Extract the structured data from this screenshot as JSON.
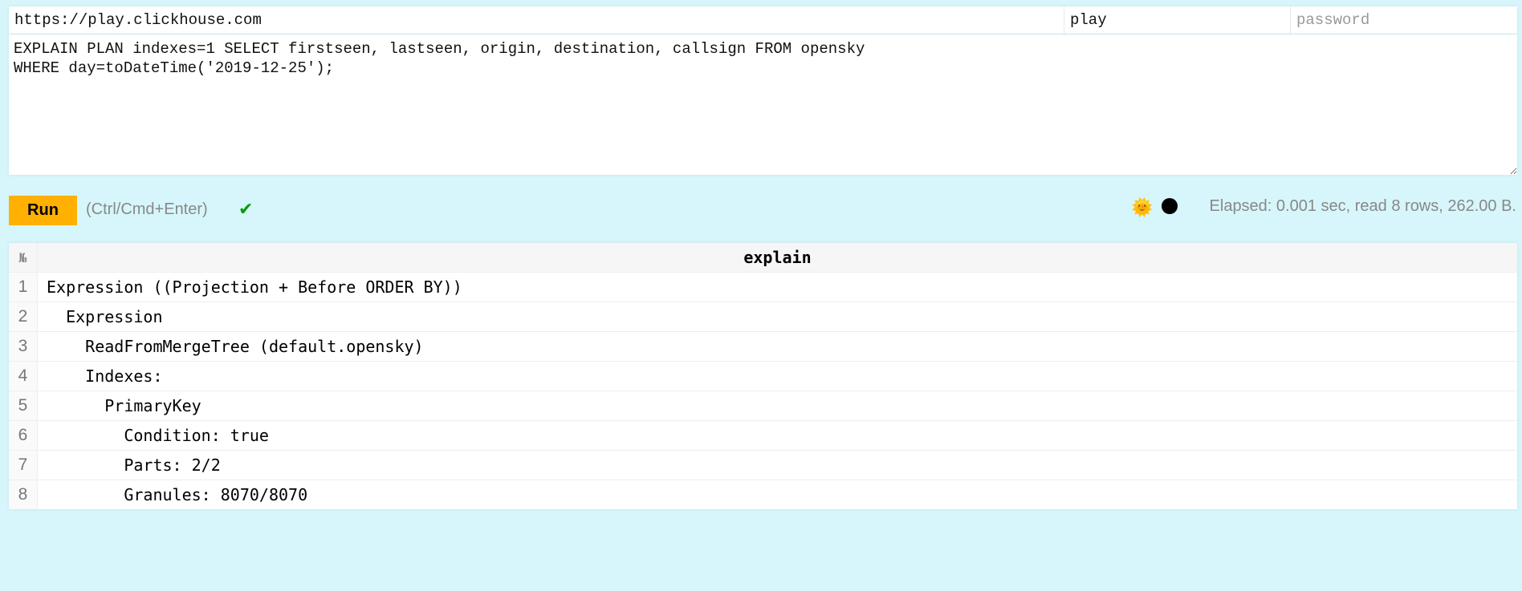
{
  "connection": {
    "url": "https://play.clickhouse.com",
    "user": "play",
    "password_placeholder": "password"
  },
  "query": {
    "text": "EXPLAIN PLAN indexes=1 SELECT firstseen, lastseen, origin, destination, callsign FROM opensky\nWHERE day=toDateTime('2019-12-25');"
  },
  "toolbar": {
    "run_label": "Run",
    "hint": "(Ctrl/Cmd+Enter)",
    "status_icon": "✔",
    "theme_icon": "🌞",
    "elapsed": "Elapsed: 0.001 sec, read 8 rows, 262.00 B."
  },
  "results": {
    "row_number_header": "№",
    "columns": [
      "explain"
    ],
    "rows": [
      {
        "num": "1",
        "explain": "Expression ((Projection + Before ORDER BY))"
      },
      {
        "num": "2",
        "explain": "  Expression"
      },
      {
        "num": "3",
        "explain": "    ReadFromMergeTree (default.opensky)"
      },
      {
        "num": "4",
        "explain": "    Indexes:"
      },
      {
        "num": "5",
        "explain": "      PrimaryKey"
      },
      {
        "num": "6",
        "explain": "        Condition: true"
      },
      {
        "num": "7",
        "explain": "        Parts: 2/2"
      },
      {
        "num": "8",
        "explain": "        Granules: 8070/8070"
      }
    ]
  },
  "colors": {
    "background": "#d6f6fb",
    "run_button": "#ffb000",
    "success": "#0a9a0a"
  }
}
